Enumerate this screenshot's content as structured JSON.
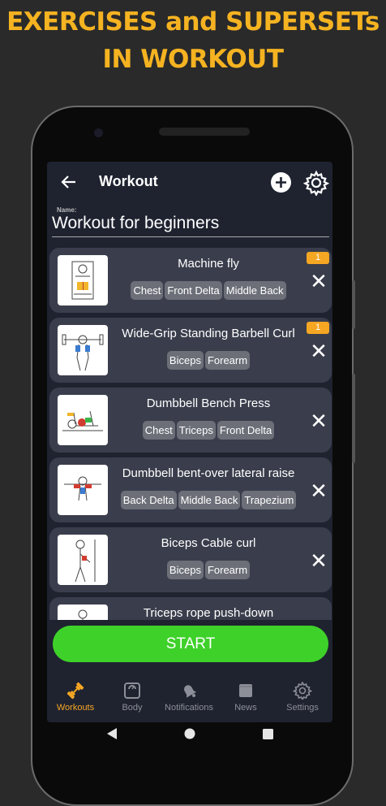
{
  "promo": {
    "line1": "EXERCISES and SUPERSETs",
    "line2": "IN WORKOUT"
  },
  "header": {
    "title": "Workout",
    "back_icon": "arrow-left-icon",
    "add_icon": "plus-circle-icon",
    "settings_icon": "gear-icon"
  },
  "name_field": {
    "label": "Name:",
    "value": "Workout for beginners"
  },
  "exercises": [
    {
      "name": "Machine fly",
      "tags": [
        "Chest",
        "Front Delta",
        "Middle Back"
      ],
      "badge": "1"
    },
    {
      "name": "Wide-Grip Standing Barbell Curl",
      "tags": [
        "Biceps",
        "Forearm"
      ],
      "badge": "1"
    },
    {
      "name": "Dumbbell Bench Press",
      "tags": [
        "Chest",
        "Triceps",
        "Front Delta"
      ]
    },
    {
      "name": "Dumbbell bent-over lateral raise",
      "tags": [
        "Back Delta",
        "Middle Back",
        "Trapezium"
      ]
    },
    {
      "name": "Biceps Cable curl",
      "tags": [
        "Biceps",
        "Forearm"
      ]
    },
    {
      "name": "Triceps rope push-down",
      "tags": []
    }
  ],
  "start_label": "START",
  "nav": [
    {
      "label": "Workouts",
      "icon": "dumbbell-icon",
      "active": true
    },
    {
      "label": "Body",
      "icon": "scale-icon",
      "active": false
    },
    {
      "label": "Notifications",
      "icon": "bell-icon",
      "active": false
    },
    {
      "label": "News",
      "icon": "news-icon",
      "active": false
    },
    {
      "label": "Settings",
      "icon": "gear-icon",
      "active": false
    }
  ],
  "colors": {
    "accent": "#f5a623",
    "start": "#3ed12a",
    "background": "#1f2330",
    "card": "#3a3e4c"
  }
}
